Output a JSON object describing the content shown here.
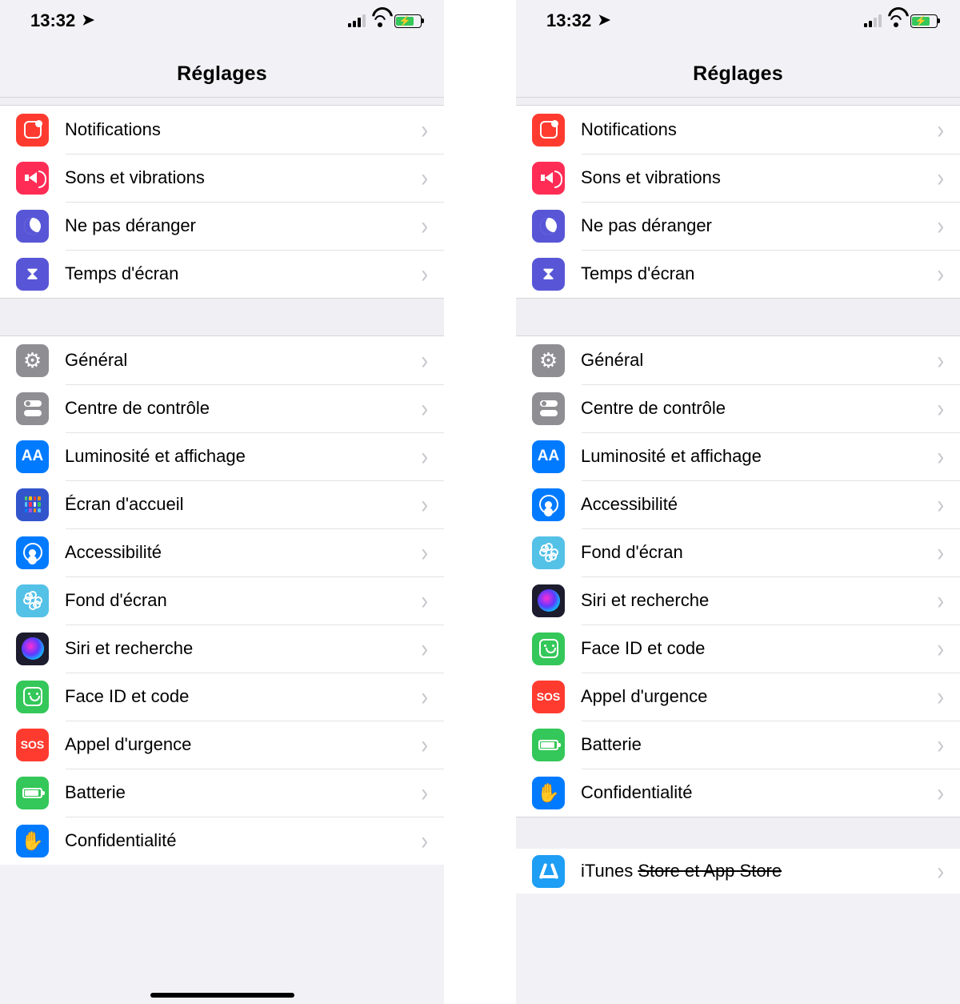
{
  "status": {
    "time": "13:32"
  },
  "header": {
    "title": "Réglages"
  },
  "left": {
    "group1": [
      {
        "label": "Notifications"
      },
      {
        "label": "Sons et vibrations"
      },
      {
        "label": "Ne pas déranger"
      },
      {
        "label": "Temps d'écran"
      }
    ],
    "group2": [
      {
        "label": "Général"
      },
      {
        "label": "Centre de contrôle"
      },
      {
        "label": "Luminosité et affichage"
      },
      {
        "label": "Écran d'accueil"
      },
      {
        "label": "Accessibilité"
      },
      {
        "label": "Fond d'écran"
      },
      {
        "label": "Siri et recherche"
      },
      {
        "label": "Face ID et code"
      },
      {
        "label": "Appel d'urgence"
      },
      {
        "label": "Batterie"
      },
      {
        "label": "Confidentialité"
      }
    ],
    "sos": "SOS"
  },
  "right": {
    "group1": [
      {
        "label": "Notifications"
      },
      {
        "label": "Sons et vibrations"
      },
      {
        "label": "Ne pas déranger"
      },
      {
        "label": "Temps d'écran"
      }
    ],
    "group2": [
      {
        "label": "Général"
      },
      {
        "label": "Centre de contrôle"
      },
      {
        "label": "Luminosité et affichage"
      },
      {
        "label": "Accessibilité"
      },
      {
        "label": "Fond d'écran"
      },
      {
        "label": "Siri et recherche"
      },
      {
        "label": "Face ID et code"
      },
      {
        "label": "Appel d'urgence"
      },
      {
        "label": "Batterie"
      },
      {
        "label": "Confidentialité"
      }
    ],
    "group3": [
      {
        "label_prefix": "iTunes ",
        "label_strike": "Store et App Store"
      }
    ],
    "sos": "SOS"
  },
  "aa": "AA"
}
